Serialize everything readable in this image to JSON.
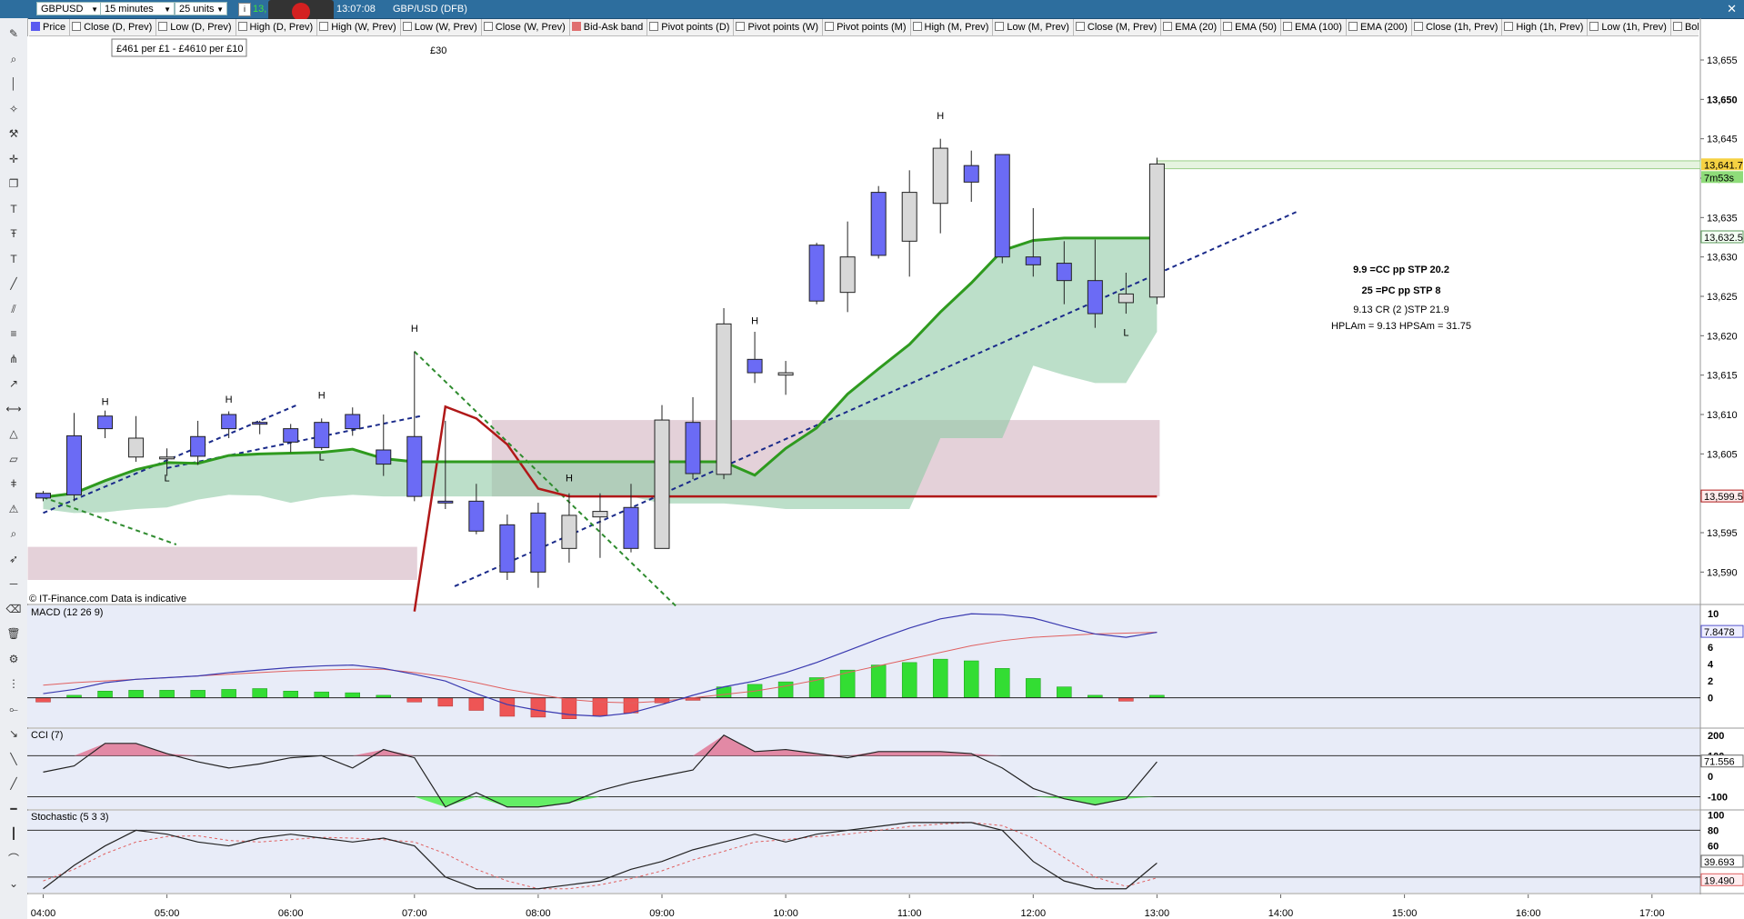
{
  "toolbar": {
    "instrument_select": "GBPUSD",
    "timeframe_select": "15 minutes",
    "units_select": "25 units",
    "time": "13:07:08",
    "instrument_label": "GBP/USD (DFB)",
    "price_partial": "13,"
  },
  "legend": [
    {
      "label": "Price",
      "color": "#5a5af0"
    },
    {
      "label": "Close (D, Prev)",
      "color": ""
    },
    {
      "label": "Low (D, Prev)",
      "color": ""
    },
    {
      "label": "High (D, Prev)",
      "color": ""
    },
    {
      "label": "High (W, Prev)",
      "color": ""
    },
    {
      "label": "Low (W, Prev)",
      "color": ""
    },
    {
      "label": "Close (W, Prev)",
      "color": ""
    },
    {
      "label": "Bid-Ask band",
      "color": "#e07070"
    },
    {
      "label": "Pivot points (D)",
      "color": ""
    },
    {
      "label": "Pivot points (W)",
      "color": ""
    },
    {
      "label": "Pivot points (M)",
      "color": ""
    },
    {
      "label": "High (M, Prev)",
      "color": ""
    },
    {
      "label": "Low (M, Prev)",
      "color": ""
    },
    {
      "label": "Close (M, Prev)",
      "color": ""
    },
    {
      "label": "EMA (20)",
      "color": ""
    },
    {
      "label": "EMA (50)",
      "color": ""
    },
    {
      "label": "EMA (100)",
      "color": ""
    },
    {
      "label": "EMA (200)",
      "color": ""
    },
    {
      "label": "Close (1h, Prev)",
      "color": ""
    },
    {
      "label": "High (1h, Prev)",
      "color": ""
    },
    {
      "label": "Low (1h, Prev)",
      "color": ""
    },
    {
      "label": "Bolli",
      "color": ""
    }
  ],
  "tooltip": "£461 per £1 - £4610 per £10",
  "annotation_cost": "£30",
  "watermark": "© IT-Finance.com  Data is indicative",
  "notes": [
    {
      "text": "9.9 =CC pp STP 20.2",
      "color": "#1a237e"
    },
    {
      "text": "25 =PC pp STP 8",
      "color": "#2e8b2e"
    },
    {
      "text": "9.13   CR (2 )STP 21.9",
      "color": "#222222"
    },
    {
      "text": "HPLAm = 9.13    HPSAm = 31.75",
      "color": "#8b1a2a"
    }
  ],
  "colors": {
    "bull": "#6b6bf5",
    "bear": "#d8d8d8",
    "ema_green": "#2e9a1e",
    "red_line": "#b01818",
    "cloud_green": "#8fc9a5",
    "band_pink": "#d6b8c4",
    "trend_blue": "#1a2a8a",
    "trend_green": "#2e8b2e",
    "macd_pos": "#33dd33",
    "macd_neg": "#ee5555",
    "panel_bg": "#e8ecf8"
  },
  "chart_data": [
    {
      "type": "candlestick",
      "title": "GBPUSD 15 minutes",
      "x": [
        "04:00",
        "04:15",
        "04:30",
        "04:45",
        "05:00",
        "05:15",
        "05:30",
        "05:45",
        "06:00",
        "06:15",
        "06:30",
        "06:45",
        "07:00",
        "07:15",
        "07:30",
        "07:45",
        "08:00",
        "08:15",
        "08:30",
        "08:45",
        "09:00",
        "09:15",
        "09:30",
        "09:45",
        "10:00",
        "10:15",
        "10:30",
        "10:45",
        "11:00",
        "11:15",
        "11:30",
        "11:45",
        "12:00",
        "12:15",
        "12:30",
        "12:45",
        "13:00"
      ],
      "open": [
        13599.4,
        13599.8,
        13608.2,
        13607.0,
        13604.6,
        13604.7,
        13608.2,
        13608.8,
        13606.5,
        13605.8,
        13608.2,
        13603.7,
        13599.6,
        13598.8,
        13595.2,
        13590.0,
        13590.0,
        13597.2,
        13597.7,
        13593.0,
        13609.3,
        13602.5,
        13621.5,
        13615.3,
        13615.3,
        13624.4,
        13630.0,
        13630.2,
        13638.2,
        13643.8,
        13639.5,
        13630.0,
        13629.0,
        13627.0,
        13622.8,
        13625.3,
        13641.8
      ],
      "close": [
        13600.0,
        13607.3,
        13609.8,
        13604.6,
        13604.4,
        13607.2,
        13610.0,
        13609.0,
        13608.2,
        13609.0,
        13610.0,
        13605.5,
        13607.2,
        13599.0,
        13599.0,
        13596.0,
        13597.5,
        13593.0,
        13597.0,
        13598.2,
        13593.0,
        13609.0,
        13602.4,
        13617.0,
        13615.0,
        13631.5,
        13625.5,
        13638.2,
        13632.0,
        13636.8,
        13641.6,
        13643.0,
        13630.0,
        13629.2,
        13627.0,
        13624.2,
        13624.9
      ],
      "high": [
        13600.3,
        13610.2,
        13610.5,
        13609.8,
        13605.7,
        13609.2,
        13610.4,
        13609.2,
        13608.8,
        13609.5,
        13610.9,
        13610.0,
        13618.0,
        13609.2,
        13601.2,
        13597.3,
        13598.8,
        13600.0,
        13600.0,
        13601.2,
        13611.2,
        13612.2,
        13623.5,
        13620.5,
        13616.8,
        13631.8,
        13634.5,
        13639.0,
        13641.0,
        13645.0,
        13643.5,
        13643.0,
        13636.2,
        13632.0,
        13632.2,
        13628.0,
        13642.6
      ],
      "low": [
        13599.0,
        13599.0,
        13607.0,
        13604.0,
        13602.2,
        13603.6,
        13607.0,
        13607.5,
        13605.2,
        13605.5,
        13607.3,
        13602.2,
        13599.0,
        13598.0,
        13594.8,
        13589.0,
        13588.0,
        13591.2,
        13591.8,
        13592.5,
        13593.0,
        13601.8,
        13601.8,
        13614.0,
        13612.5,
        13624.0,
        13623.0,
        13629.8,
        13627.5,
        13633.0,
        13637.0,
        13629.2,
        13627.5,
        13624.0,
        13621.0,
        13622.8,
        13624.0
      ],
      "ema_green": [
        13599.5,
        13600.0,
        13601.6,
        13603.0,
        13603.9,
        13603.8,
        13604.8,
        13605.0,
        13605.1,
        13605.2,
        13605.6,
        13604.4,
        13604.0,
        13604.0,
        13604.0,
        13604.0,
        13604.0,
        13604.0,
        13604.0,
        13604.0,
        13604.0,
        13604.0,
        13604.0,
        13602.3,
        13605.7,
        13608.3,
        13612.6,
        13615.8,
        13618.9,
        13623.0,
        13626.7,
        13630.8,
        13632.1,
        13632.4,
        13632.4,
        13632.4,
        13632.4
      ],
      "cloud_low": [
        13598.0,
        13597.5,
        13597.6,
        13598.0,
        13598.2,
        13599.2,
        13599.8,
        13599.7,
        13598.8,
        13599.5,
        13599.8,
        13599.6,
        13599.6,
        13599.6,
        13599.6,
        13599.6,
        13599.6,
        13599.6,
        13599.6,
        13599.6,
        13598.7,
        13598.7,
        13598.7,
        13598.4,
        13598.0,
        13598.0,
        13598.0,
        13598.0,
        13598.0,
        13607.0,
        13607.0,
        13607.0,
        13616.2,
        13615.0,
        13614.0,
        13614.0,
        13620.5
      ],
      "red_line": [
        null,
        null,
        null,
        null,
        null,
        null,
        null,
        null,
        null,
        null,
        null,
        null,
        13585,
        13611,
        13609.5,
        13606.2,
        13600.6,
        13599.6,
        13599.6,
        13599.6,
        13599.6,
        13599.6,
        13599.6,
        13599.6,
        13599.6,
        13599.6,
        13599.6,
        13599.6,
        13599.6,
        13599.6,
        13599.6,
        13599.6,
        13599.6,
        13599.6,
        13599.6,
        13599.6,
        13599.6
      ],
      "pink_band_1": {
        "from": "04:00",
        "to": "07:00",
        "low": 13589,
        "high": 13593.2
      },
      "pink_band_2": {
        "from": "07:45",
        "to": "13:00",
        "low": 13599.6,
        "high": 13609.3
      },
      "current_price_band": {
        "from": "13:00",
        "low": 13641.2,
        "high": 13642.2
      },
      "swing_marks": [
        {
          "x": "04:30",
          "label": "H",
          "y": 13611.2
        },
        {
          "x": "05:30",
          "label": "H",
          "y": 13611.5
        },
        {
          "x": "06:15",
          "label": "H",
          "y": 13612.0
        },
        {
          "x": "07:00",
          "label": "H",
          "y": 13620.5
        },
        {
          "x": "05:00",
          "label": "L",
          "y": 13601.5
        },
        {
          "x": "06:15",
          "label": "L",
          "y": 13604.2
        },
        {
          "x": "08:15",
          "label": "H",
          "y": 13601.5
        },
        {
          "x": "09:45",
          "label": "H",
          "y": 13621.5
        },
        {
          "x": "11:15",
          "label": "H",
          "y": 13647.5
        },
        {
          "x": "12:45",
          "label": "L",
          "y": 13620.0
        }
      ],
      "price_labels": [
        {
          "value": "13,641.7",
          "kind": "current"
        },
        {
          "value": "7m53s",
          "kind": "countdown"
        },
        {
          "value": "13,632.5",
          "kind": "ema"
        },
        {
          "value": "13,599.5",
          "kind": "line"
        }
      ],
      "y_ticks": [
        "13,655",
        "13,650",
        "13,645",
        "13,640",
        "13,635",
        "13,630",
        "13,625",
        "13,620",
        "13,615",
        "13,610",
        "13,605",
        "13,600",
        "13,595",
        "13,590"
      ],
      "y_tick_values": [
        13655,
        13650,
        13645,
        13640,
        13635,
        13630,
        13625,
        13620,
        13615,
        13610,
        13605,
        13600,
        13595,
        13590
      ],
      "x_ticks": [
        "04:00",
        "05:00",
        "06:00",
        "07:00",
        "08:00",
        "09:00",
        "10:00",
        "11:00",
        "12:00",
        "13:00",
        "14:00",
        "15:00",
        "16:00",
        "17:00"
      ],
      "ylim": [
        13586,
        13658
      ]
    },
    {
      "type": "bar",
      "title": "MACD (12 26 9)",
      "histogram": [
        -0.5,
        0.3,
        0.8,
        0.9,
        0.9,
        0.9,
        1.0,
        1.1,
        0.8,
        0.7,
        0.6,
        0.3,
        -0.5,
        -1.0,
        -1.5,
        -2.2,
        -2.3,
        -2.5,
        -2.1,
        -1.8,
        -0.6,
        -0.3,
        1.3,
        1.6,
        1.9,
        2.4,
        3.3,
        3.9,
        4.2,
        4.6,
        4.4,
        3.5,
        2.3,
        1.3,
        0.3,
        -0.4,
        0.3
      ],
      "macd_line": [
        0.5,
        1.0,
        1.8,
        2.2,
        2.4,
        2.6,
        3.0,
        3.3,
        3.6,
        3.8,
        3.9,
        3.5,
        2.8,
        2.0,
        0.5,
        -0.8,
        -1.5,
        -2.0,
        -2.2,
        -1.8,
        -0.8,
        0.3,
        1.3,
        2.0,
        3.0,
        4.2,
        5.6,
        7.0,
        8.3,
        9.4,
        10.0,
        9.9,
        9.5,
        8.5,
        7.6,
        7.2,
        7.8
      ],
      "signal_line": [
        1.5,
        1.8,
        2.0,
        2.2,
        2.4,
        2.6,
        2.8,
        3.0,
        3.2,
        3.3,
        3.4,
        3.4,
        3.0,
        2.5,
        1.8,
        1.0,
        0.4,
        -0.2,
        -0.5,
        -0.6,
        -0.4,
        0.0,
        0.4,
        0.8,
        1.4,
        2.1,
        3.0,
        3.8,
        4.6,
        5.4,
        6.2,
        6.8,
        7.2,
        7.4,
        7.6,
        7.7,
        7.8
      ],
      "y_ticks": [
        "10",
        "8",
        "6",
        "4",
        "2",
        "0"
      ],
      "y_tick_values": [
        10,
        8,
        6,
        4,
        2,
        0
      ],
      "value_label": "7.8478",
      "ylim": [
        -3.5,
        11
      ]
    },
    {
      "type": "line",
      "title": "CCI (7)",
      "values": [
        20,
        50,
        160,
        160,
        110,
        70,
        40,
        60,
        90,
        100,
        40,
        130,
        90,
        -150,
        -80,
        -150,
        -150,
        -130,
        -70,
        -30,
        0,
        30,
        200,
        120,
        130,
        110,
        90,
        120,
        120,
        120,
        110,
        40,
        -60,
        -110,
        -140,
        -110,
        70
      ],
      "y_ticks": [
        "200",
        "100",
        "0",
        "-100"
      ],
      "y_tick_values": [
        200,
        100,
        0,
        -100
      ],
      "value_label": "71.556",
      "ylim": [
        -160,
        230
      ]
    },
    {
      "type": "line",
      "title": "Stochastic (5 3 3)",
      "k": [
        5,
        35,
        60,
        80,
        75,
        65,
        60,
        70,
        75,
        70,
        65,
        70,
        60,
        20,
        5,
        5,
        5,
        10,
        15,
        30,
        40,
        55,
        65,
        75,
        65,
        75,
        80,
        85,
        90,
        90,
        90,
        80,
        40,
        15,
        5,
        5,
        38
      ],
      "d": [
        15,
        30,
        50,
        65,
        72,
        73,
        67,
        65,
        68,
        71,
        70,
        68,
        65,
        50,
        30,
        15,
        5,
        5,
        10,
        18,
        28,
        42,
        53,
        65,
        68,
        72,
        75,
        80,
        85,
        88,
        90,
        86,
        70,
        45,
        20,
        8,
        19
      ],
      "y_ticks": [
        "100",
        "80",
        "60",
        "40",
        "20"
      ],
      "y_tick_values": [
        100,
        80,
        60,
        40,
        20
      ],
      "k_label": "39.693",
      "d_label": "19.490",
      "ylim": [
        0,
        105
      ]
    }
  ]
}
